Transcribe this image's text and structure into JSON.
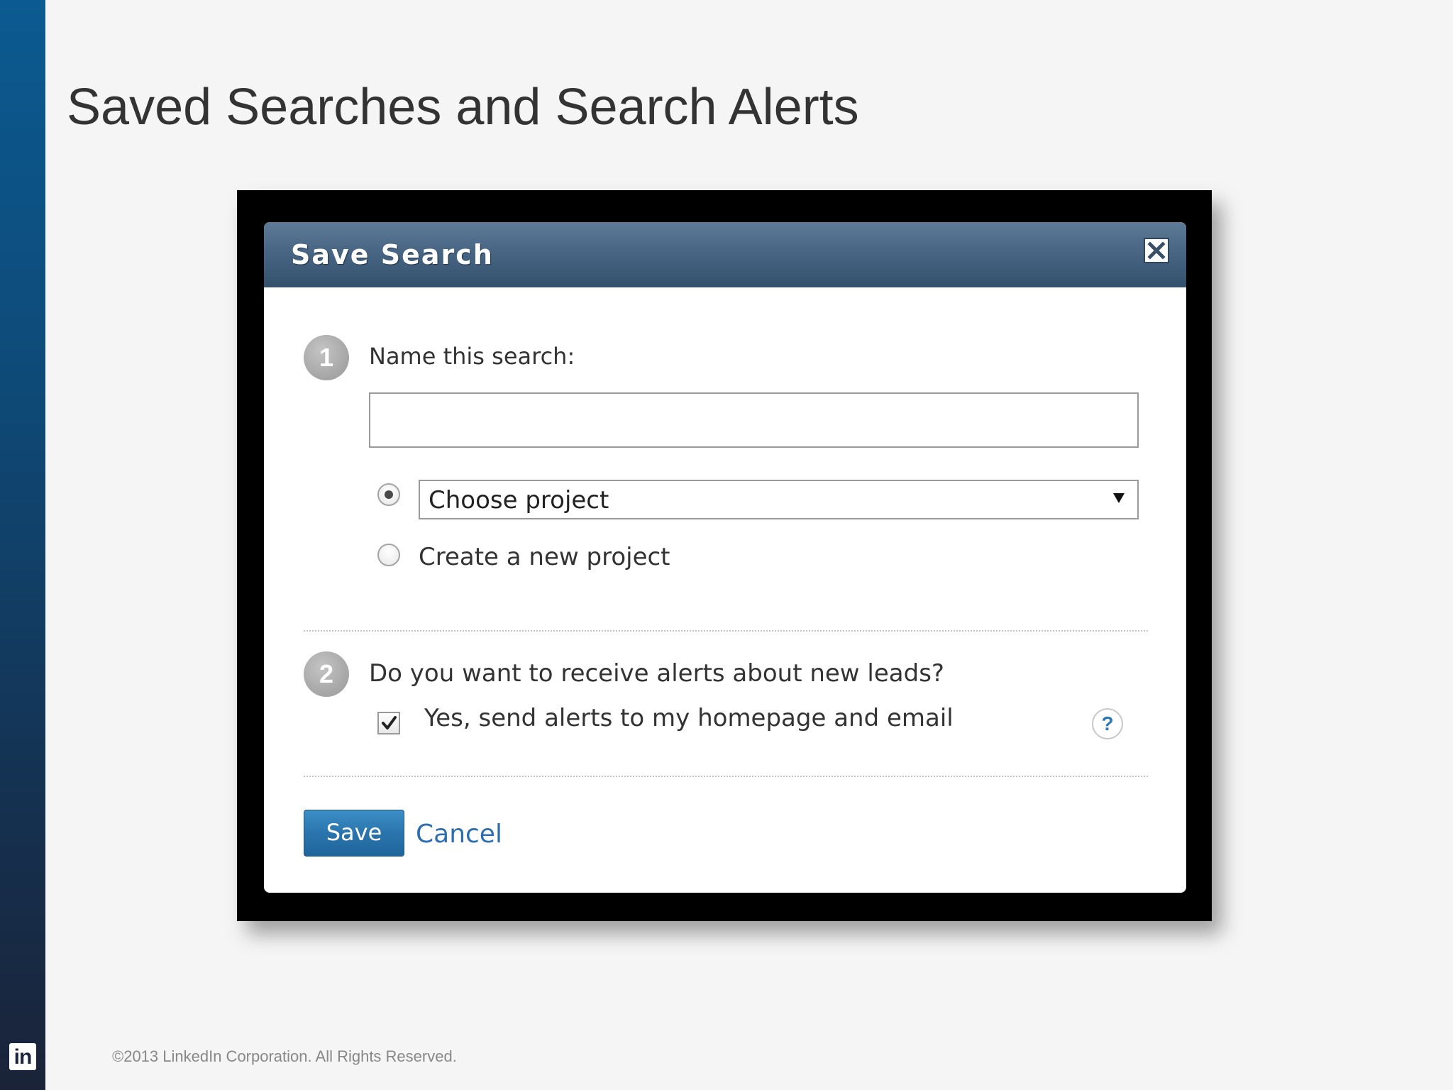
{
  "slide": {
    "title": "Saved Searches and Search Alerts",
    "footer": "©2013 LinkedIn Corporation. All Rights Reserved.",
    "logo_text": "in"
  },
  "dialog": {
    "title": "Save Search",
    "step1": {
      "number": "1",
      "label": "Name this search:",
      "name_value": "",
      "project_select_value": "Choose project",
      "create_project_label": "Create a new project",
      "selected_option": "choose-project"
    },
    "step2": {
      "number": "2",
      "question": "Do you want to receive alerts about new leads?",
      "alert_label": "Yes, send alerts to my homepage and email",
      "alert_checked": true,
      "help_symbol": "?"
    },
    "buttons": {
      "save_label": "Save",
      "cancel_label": "Cancel"
    }
  },
  "icons": {
    "close": "close-icon",
    "dropdown": "chevron-down-icon",
    "checkmark": "checkmark-icon",
    "help": "help-icon",
    "logo": "linkedin-logo-icon"
  },
  "colors": {
    "header_gradient_top": "#5e7a97",
    "header_gradient_bottom": "#33506c",
    "save_button": "#2a74ad",
    "link": "#2d6eb0",
    "sidebar_top": "#0b5a91",
    "sidebar_bottom": "#1a2338"
  }
}
